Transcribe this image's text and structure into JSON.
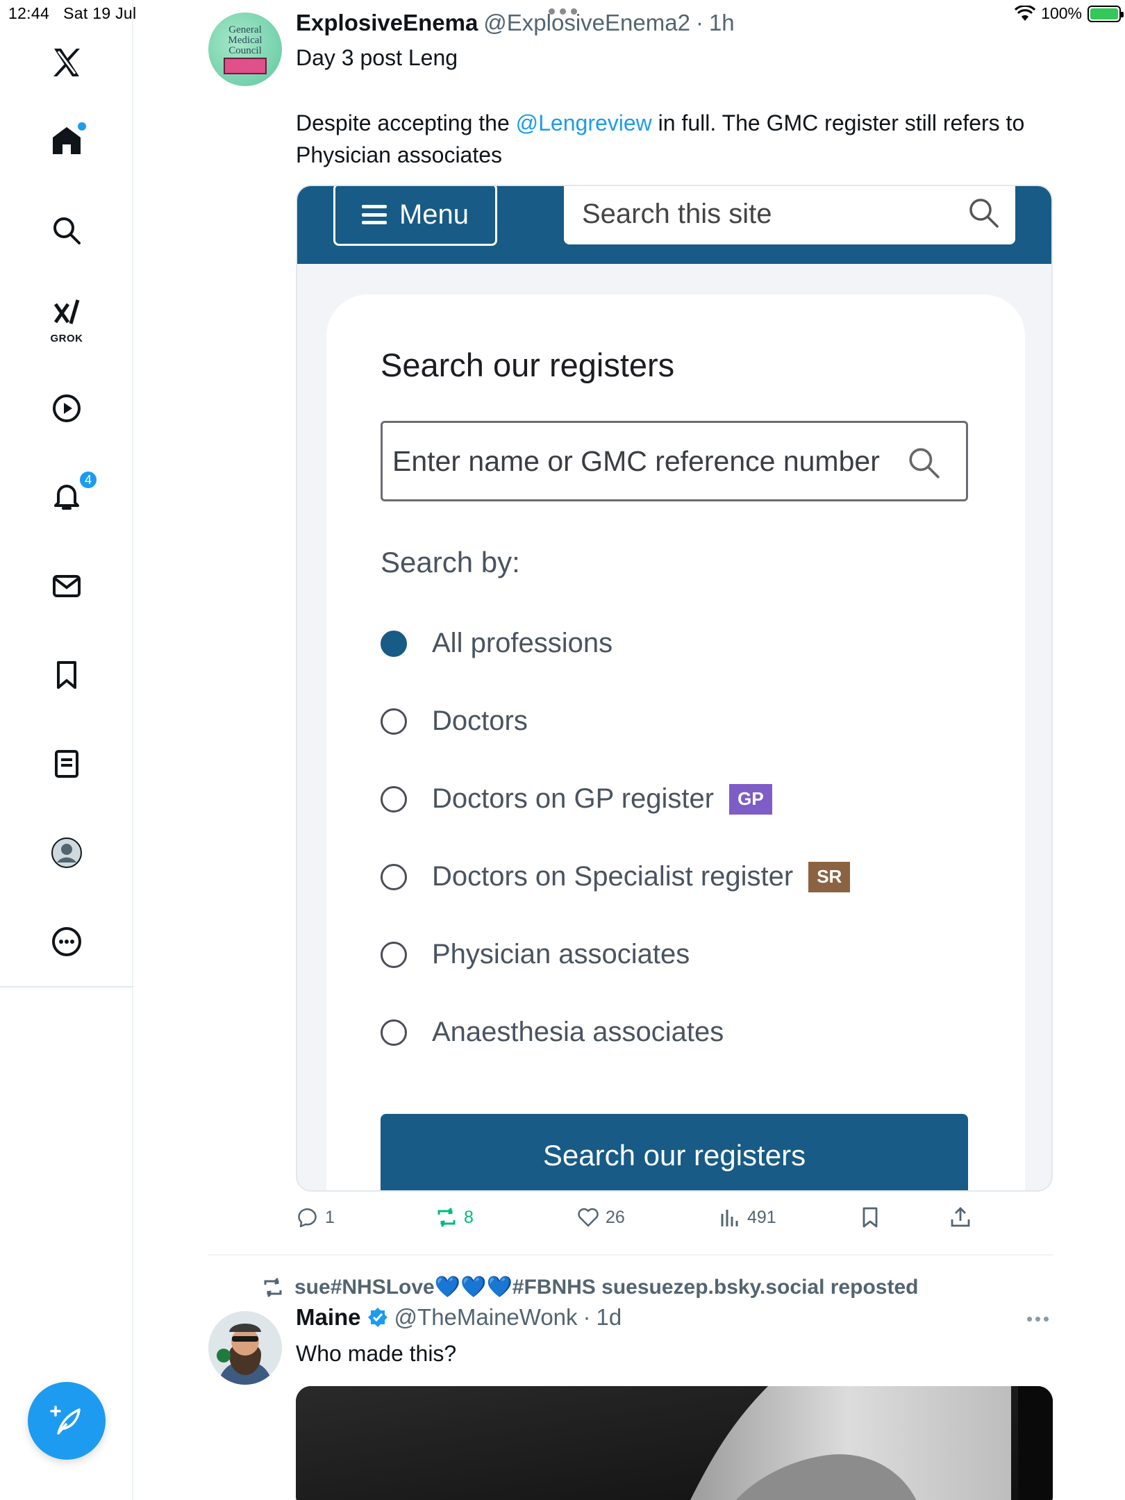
{
  "status_bar": {
    "time": "12:44",
    "date": "Sat 19 Jul",
    "battery": "100%"
  },
  "sidebar": {
    "items": [
      {
        "name": "x-logo-icon"
      },
      {
        "name": "home-icon"
      },
      {
        "name": "search-icon"
      },
      {
        "name": "grok-icon",
        "label": "GROK"
      },
      {
        "name": "video-icon"
      },
      {
        "name": "notifications-icon",
        "badge": "4"
      },
      {
        "name": "messages-icon"
      },
      {
        "name": "bookmarks-icon"
      },
      {
        "name": "lists-icon"
      },
      {
        "name": "profile-icon"
      },
      {
        "name": "more-icon"
      }
    ],
    "compose_icon": "feather-plus-icon"
  },
  "tweet1": {
    "name": "ExplosiveEnema",
    "handle": "@ExplosiveEnema2",
    "sep": "·",
    "time": "1h",
    "line1": "Day 3 post Leng",
    "line2_pre": "Despite accepting the ",
    "line2_mention": "@Lengreview",
    "line2_post": " in full. The GMC register still refers to Physician associates",
    "avatar_text": [
      "General",
      "Medical",
      "Council"
    ],
    "media": {
      "menu_label": "Menu",
      "site_search_placeholder": "Search this site",
      "heading": "Search our registers",
      "input_placeholder": "Enter name or GMC reference number",
      "search_by": "Search by:",
      "options": [
        {
          "label": "All professions",
          "checked": true,
          "tag": ""
        },
        {
          "label": "Doctors",
          "checked": false,
          "tag": ""
        },
        {
          "label": "Doctors on GP register",
          "checked": false,
          "tag": "GP"
        },
        {
          "label": "Doctors on Specialist register",
          "checked": false,
          "tag": "SR"
        },
        {
          "label": "Physician associates",
          "checked": false,
          "tag": ""
        },
        {
          "label": "Anaesthesia associates",
          "checked": false,
          "tag": ""
        }
      ],
      "button_label": "Search our registers",
      "accent_color": "#175b86"
    },
    "actions": {
      "replies": "1",
      "reposts": "8",
      "likes": "26",
      "views": "491"
    }
  },
  "tweet2": {
    "repost_text": "sue#NHSLove💙💙💙#FBNHS suesuezep.bsky.social reposted",
    "name": "Maine",
    "handle": "@TheMaineWonk",
    "sep": "·",
    "time": "1d",
    "text": "Who made this?"
  }
}
